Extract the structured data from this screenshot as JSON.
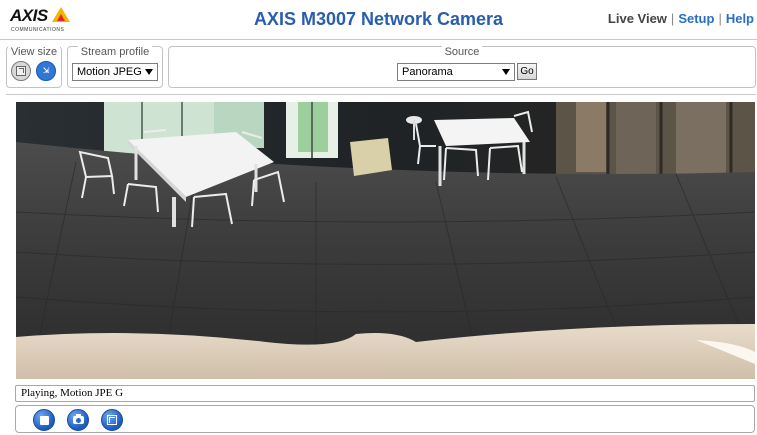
{
  "header": {
    "logo_word": "AXIS",
    "logo_sub": "COMMUNICATIONS",
    "title": "AXIS M3007 Network Camera",
    "nav": {
      "live_view": "Live View",
      "setup": "Setup",
      "help": "Help",
      "separator": "|"
    }
  },
  "controls": {
    "view_size": {
      "label": "View size"
    },
    "stream_profile": {
      "label": "Stream profile",
      "selected": "Motion JPEG"
    },
    "source": {
      "label": "Source",
      "selected": "Panorama",
      "go_label": "Go"
    }
  },
  "status": {
    "text": "Playing, Motion JPE G"
  },
  "toolbar": {
    "buttons": [
      {
        "icon": "stop-icon"
      },
      {
        "icon": "camera-icon"
      },
      {
        "icon": "fullscreen-icon"
      }
    ]
  },
  "colors": {
    "title_blue": "#2a5dad",
    "link_blue": "#2a6ec4",
    "button_blue": "#1f5fc3",
    "logo_yellow": "#f3b500",
    "logo_red": "#e3262a"
  }
}
